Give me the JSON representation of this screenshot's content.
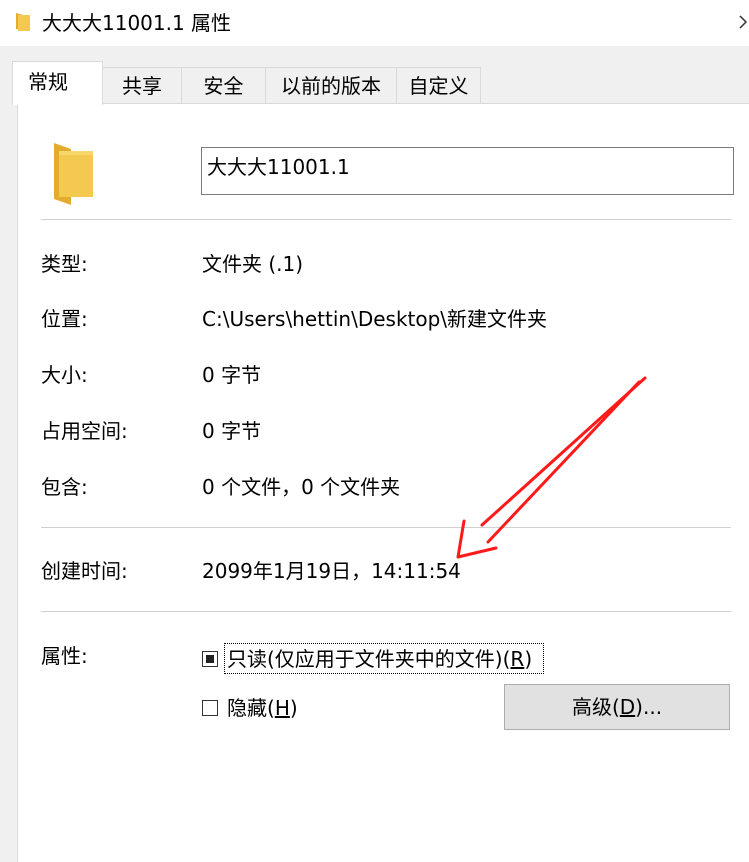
{
  "window": {
    "title": "大大大11001.1 属性"
  },
  "tabs": [
    {
      "label": "常规"
    },
    {
      "label": "共享"
    },
    {
      "label": "安全"
    },
    {
      "label": "以前的版本"
    },
    {
      "label": "自定义"
    }
  ],
  "general": {
    "name_value": "大大大11001.1",
    "rows": [
      {
        "label": "类型:",
        "value": "文件夹 (.1)"
      },
      {
        "label": "位置:",
        "value": "C:\\Users\\hettin\\Desktop\\新建文件夹"
      },
      {
        "label": "大小:",
        "value": "0 字节"
      },
      {
        "label": "占用空间:",
        "value": "0 字节"
      },
      {
        "label": "包含:",
        "value": "0 个文件，0 个文件夹"
      }
    ],
    "created": {
      "label": "创建时间:",
      "value": "2099年1月19日，14:11:54"
    },
    "attributes": {
      "label": "属性:",
      "readonly": {
        "text": "只读(仅应用于文件夹中的文件)(",
        "key": "R",
        "close": ")",
        "state": "indeterminate"
      },
      "hidden": {
        "text": "隐藏(",
        "key": "H",
        "close": ")",
        "checked": false
      },
      "advanced": {
        "text": "高级(",
        "key": "D",
        "close": ")..."
      }
    }
  },
  "colors": {
    "folder": "#f3c94f",
    "folder_dark": "#e3ac2e",
    "annotation_arrow": "#ff1a1a",
    "button_bg": "#e1e1e1"
  },
  "icons": {
    "title": "folder-icon",
    "main": "folder-icon",
    "corner": "chevron-right-icon"
  }
}
